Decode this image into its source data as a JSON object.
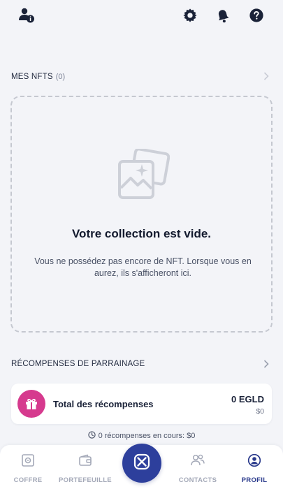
{
  "header": {
    "icons": [
      "user-info-icon",
      "gear-icon",
      "bell-icon",
      "help-icon"
    ]
  },
  "nfts": {
    "section_label": "MES NFTS",
    "count": "(0)",
    "empty_title": "Votre collection est vide.",
    "empty_description": "Vous ne possédez pas encore de NFT. Lorsque vous en aurez, ils s'afficheront ici."
  },
  "referral": {
    "section_label": "RÉCOMPENSES DE PARRAINAGE",
    "card_title": "Total des récompenses",
    "amount": "0 EGLD",
    "usd": "$0",
    "pending": "0 récompenses en cours: $0"
  },
  "nav": {
    "coffre": "COFFRE",
    "portefeuille": "PORTEFEUILLE",
    "contacts": "CONTACTS",
    "profil": "PROFIL",
    "active": "profil"
  },
  "colors": {
    "accent": "#2d3f9c",
    "gift": "#d63a8e",
    "background": "#f3f4f8"
  }
}
